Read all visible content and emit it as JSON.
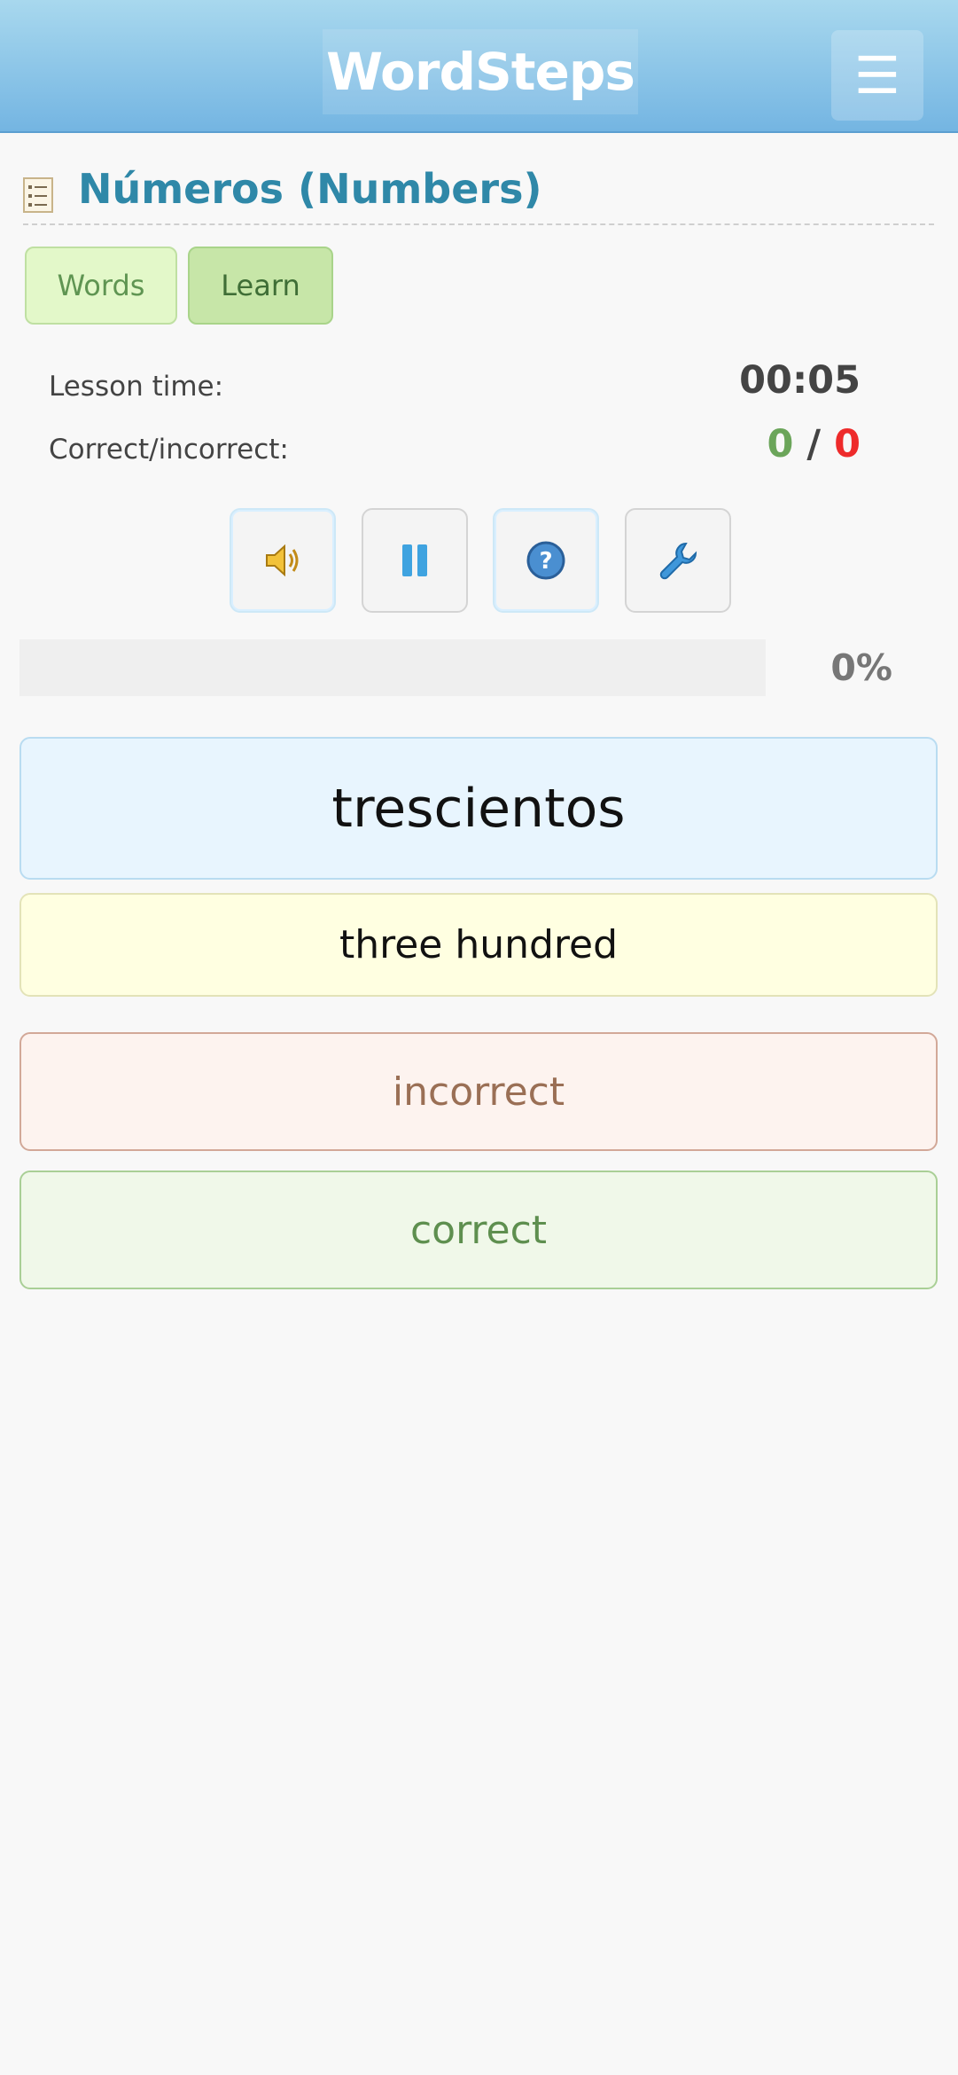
{
  "header": {
    "logo_text": "WordSteps",
    "menu_icon": "hamburger-menu-icon"
  },
  "page": {
    "title": "Números (Numbers)",
    "title_icon": "list-icon"
  },
  "tabs": [
    {
      "label": "Words",
      "active": false
    },
    {
      "label": "Learn",
      "active": true
    }
  ],
  "stats": {
    "time_label": "Lesson time:",
    "time_value": "00:05",
    "score_label": "Correct/incorrect:",
    "correct_count": "0",
    "separator": "/",
    "incorrect_count": "0"
  },
  "controls": [
    {
      "icon": "speaker-icon"
    },
    {
      "icon": "pause-icon"
    },
    {
      "icon": "help-icon"
    },
    {
      "icon": "wrench-icon"
    }
  ],
  "progress": {
    "value": 0,
    "label": "0%"
  },
  "card": {
    "word": "trescientos",
    "translation": "three hundred",
    "incorrect_label": "incorrect",
    "correct_label": "correct"
  },
  "colors": {
    "title": "#2f88a8",
    "correct": "#6ba55a",
    "incorrect": "#ee2b2b",
    "header_top": "#a8d8ee",
    "header_bottom": "#74b5e2"
  }
}
